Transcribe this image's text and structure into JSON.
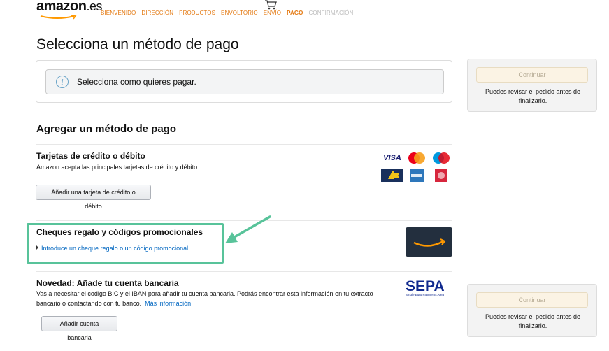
{
  "header": {
    "logo_text": "amazon",
    "logo_suffix": ".es",
    "steps": [
      {
        "label": "BIENVENIDO",
        "state": "done"
      },
      {
        "label": "DIRECCIÓN",
        "state": "done"
      },
      {
        "label": "PRODUCTOS",
        "state": "done"
      },
      {
        "label": "ENVOLTORIO",
        "state": "done"
      },
      {
        "label": "ENVÍO",
        "state": "done"
      },
      {
        "label": "PAGO",
        "state": "current"
      },
      {
        "label": "CONFIRMACIÓN",
        "state": "future"
      }
    ],
    "cart_icon": "cart-icon"
  },
  "main": {
    "title": "Selecciona un método de pago",
    "info_icon": "info-icon",
    "info_text": "Selecciona como quieres pagar.",
    "add_heading": "Agregar un método de pago",
    "cards_section": {
      "title": "Tarjetas de crédito o débito",
      "description": "Amazon acepta las principales tarjetas de crédito y débito.",
      "button_label": "Añadir una tarjeta de crédito o débito",
      "visa_label": "VISA"
    },
    "gift_section": {
      "title": "Cheques regalo y códigos promocionales",
      "link": "Introduce un cheque regalo o un código promocional"
    },
    "bank_section": {
      "title": "Novedad: Añade tu cuenta bancaria",
      "description": "Vas a necesitar el codigo BIC y el IBAN para añadir tu cuenta bancaria. Podrás encontrar esta información en tu extracto bancario o contactando con tu banco.",
      "more_link": "Más información",
      "button_label": "Añadir cuenta bancaria",
      "sepa_label": "SEPA",
      "sepa_sub": "Single Euro Payments Area"
    }
  },
  "side": {
    "continue_label": "Continuar",
    "note": "Puedes revisar el pedido antes de finalizarlo."
  },
  "colors": {
    "accent_orange": "#e47911",
    "link_blue": "#0066c0",
    "highlight_green": "#58c39a"
  }
}
